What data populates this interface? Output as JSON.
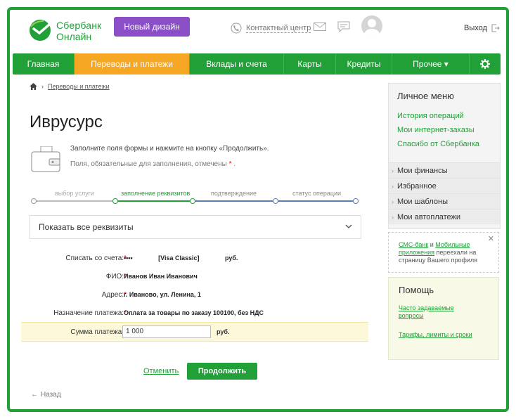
{
  "header": {
    "logo_line1": "Сбербанк",
    "logo_line2": "Онлайн",
    "new_design": "Новый дизайн",
    "contact_center": "Контактный центр",
    "exit": "Выход"
  },
  "nav": {
    "items": [
      {
        "label": "Главная"
      },
      {
        "label": "Переводы и платежи"
      },
      {
        "label": "Вклады и счета"
      },
      {
        "label": "Карты"
      },
      {
        "label": "Кредиты"
      },
      {
        "label": "Прочее ▾"
      }
    ],
    "settings_icon": "gear-icon"
  },
  "breadcrumb": {
    "current": "Переводы и платежи"
  },
  "page_title": "Иврусурс",
  "info": {
    "line1": "Заполните поля формы и нажмите на кнопку «Продолжить».",
    "line2": "Поля, обязательные для заполнения, отмечены",
    "star": "*",
    "line2_end": "."
  },
  "steps": [
    "выбор услуги",
    "заполнение реквизитов",
    "подтверждение",
    "статус операции"
  ],
  "details_toggle": "Показать все реквизиты",
  "form": {
    "account_label": "Списать со счета:",
    "account_mask": "••••",
    "account_card": "[Visa Classic]",
    "account_unit": "руб.",
    "fio_label": "ФИО:",
    "fio_value": "Иванов Иван Иванович",
    "address_label": "Адрес:",
    "address_value": "г. Иваново, ул. Ленина, 1",
    "purpose_label": "Назначение платежа:",
    "purpose_value": "Оплата за товары по заказу 100100, без НДС",
    "amount_label": "Сумма платежа:",
    "amount_value": "1 000",
    "amount_unit": "руб.",
    "star": "*"
  },
  "actions": {
    "cancel": "Отменить",
    "continue": "Продолжить",
    "back": "Назад"
  },
  "sidebar": {
    "title": "Личное меню",
    "links": [
      "История операций",
      "Мои интернет-заказы",
      "Спасибо от Сбербанка"
    ],
    "sections": [
      "Мои финансы",
      "Избранное",
      "Мои шаблоны",
      "Мои автоплатежи"
    ]
  },
  "notice": {
    "link1": "СМС-банк",
    "mid": " и ",
    "link2": "Мобильные приложения",
    "rest": " переехали на страницу Вашего профиля"
  },
  "help": {
    "title": "Помощь",
    "links": [
      "Часто задаваемые вопросы",
      "Тарифы, лимиты и сроки"
    ]
  },
  "colors": {
    "brand_green": "#21a038",
    "active_tab": "#f5a623",
    "new_design_purple": "#8a4fc6"
  }
}
